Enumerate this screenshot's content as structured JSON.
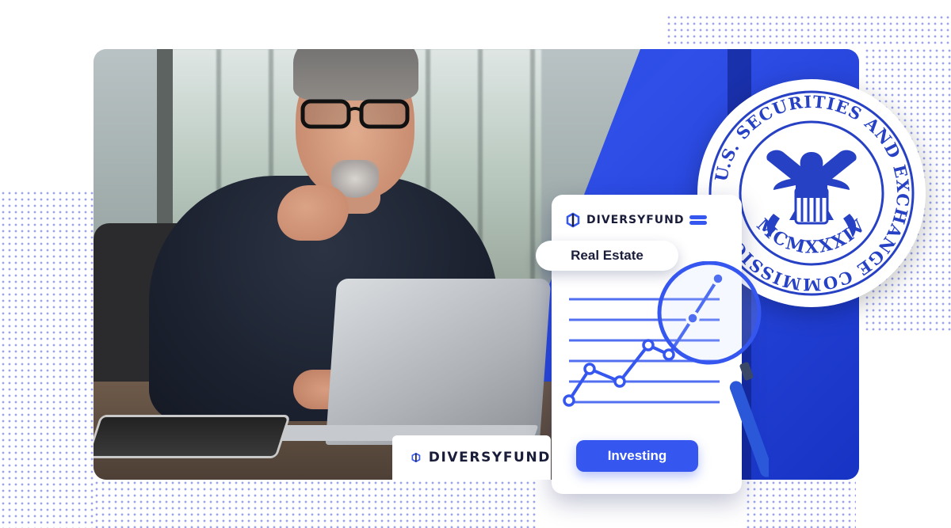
{
  "seal": {
    "ring_text": "U.S. SECURITIES AND EXCHANGE COMMISSION",
    "year_text": "MCMXXXIV",
    "color": "#2741c4"
  },
  "phone": {
    "brand": "DIVERSYFUND",
    "menu_icon": "hamburger-menu-icon",
    "category_pill": "Real Estate",
    "cta_label": "Investing"
  },
  "footer_badge": {
    "brand": "DIVERSYFUND",
    "logo_icon": "diversyfund-logo-icon"
  },
  "colors": {
    "accent": "#3557f0",
    "deep_blue": "#1e3bd6",
    "text_dark": "#1a1d3a"
  }
}
